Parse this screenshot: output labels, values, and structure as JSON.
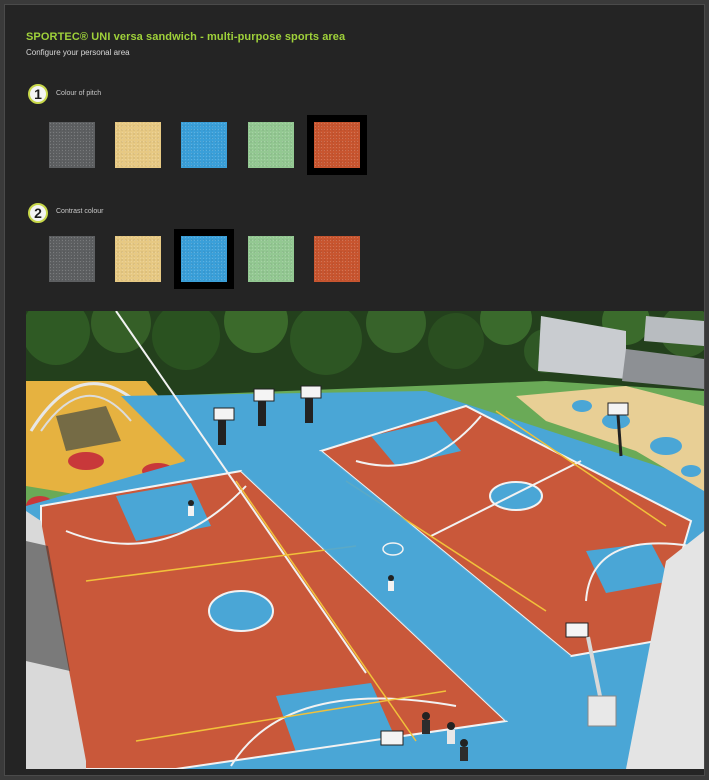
{
  "header": {
    "title": "SPORTEC® UNI versa sandwich - multi-purpose sports area",
    "subtitle": "Configure your personal area"
  },
  "steps": [
    {
      "number": "1",
      "label": "Colour of pitch",
      "selected_index": 4,
      "swatches": [
        {
          "name": "grey",
          "color": "#5d5f61"
        },
        {
          "name": "beige",
          "color": "#e7c983"
        },
        {
          "name": "blue",
          "color": "#3a9fd9"
        },
        {
          "name": "green",
          "color": "#93c892"
        },
        {
          "name": "red",
          "color": "#c8552f"
        }
      ]
    },
    {
      "number": "2",
      "label": "Contrast colour",
      "selected_index": 2,
      "swatches": [
        {
          "name": "grey",
          "color": "#5d5f61"
        },
        {
          "name": "beige",
          "color": "#e7c983"
        },
        {
          "name": "blue",
          "color": "#3a9fd9"
        },
        {
          "name": "green",
          "color": "#93c892"
        },
        {
          "name": "red",
          "color": "#c8552f"
        }
      ]
    }
  ],
  "preview": {
    "court_color": "#c9583a",
    "contrast_color": "#4aa6d6",
    "line_color": "#f2f2f2",
    "accent_line_color": "#f1c13a"
  }
}
